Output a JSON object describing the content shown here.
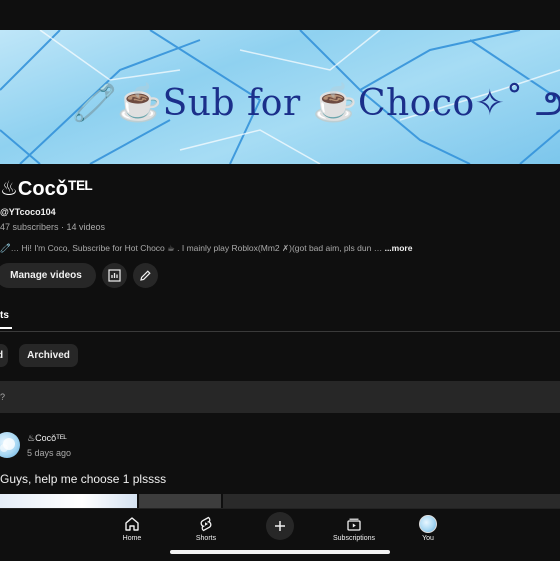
{
  "banner": {
    "text": "🧷☕Sub for ☕Choco✧˚ ౨ ⋆"
  },
  "channel": {
    "name": "♨Cocǒᵀᴱᴸ",
    "handle": "@YTcoco104",
    "stats": "47 subscribers · 14 videos",
    "description": "🧷… Hi! I'm Coco, Subscribe for Hot Choco ☕ . I mainly play Roblox(Mm2 ✗)(got bad aim, pls dun …",
    "more_label": "...more"
  },
  "actions": {
    "manage_label": "Manage videos",
    "analytics_icon": "analytics-icon",
    "edit_icon": "pencil-icon"
  },
  "tabs": {
    "active_label": "ts"
  },
  "filters": {
    "chip1_label": "d",
    "chip2_label": "Archived"
  },
  "composer": {
    "text": "?"
  },
  "post": {
    "author": "♨Cocǒᵀᴱᴸ",
    "time": "5 days ago",
    "text": "Guys, help me choose 1 plssss"
  },
  "nav": {
    "home_label": "Home",
    "shorts_label": "Shorts",
    "subscriptions_label": "Subscriptions",
    "you_label": "You"
  },
  "colors": {
    "background": "#0f0f0f",
    "surface": "#272727",
    "banner_text": "#1b2f8a",
    "banner_sky": "#8fd1f0"
  }
}
